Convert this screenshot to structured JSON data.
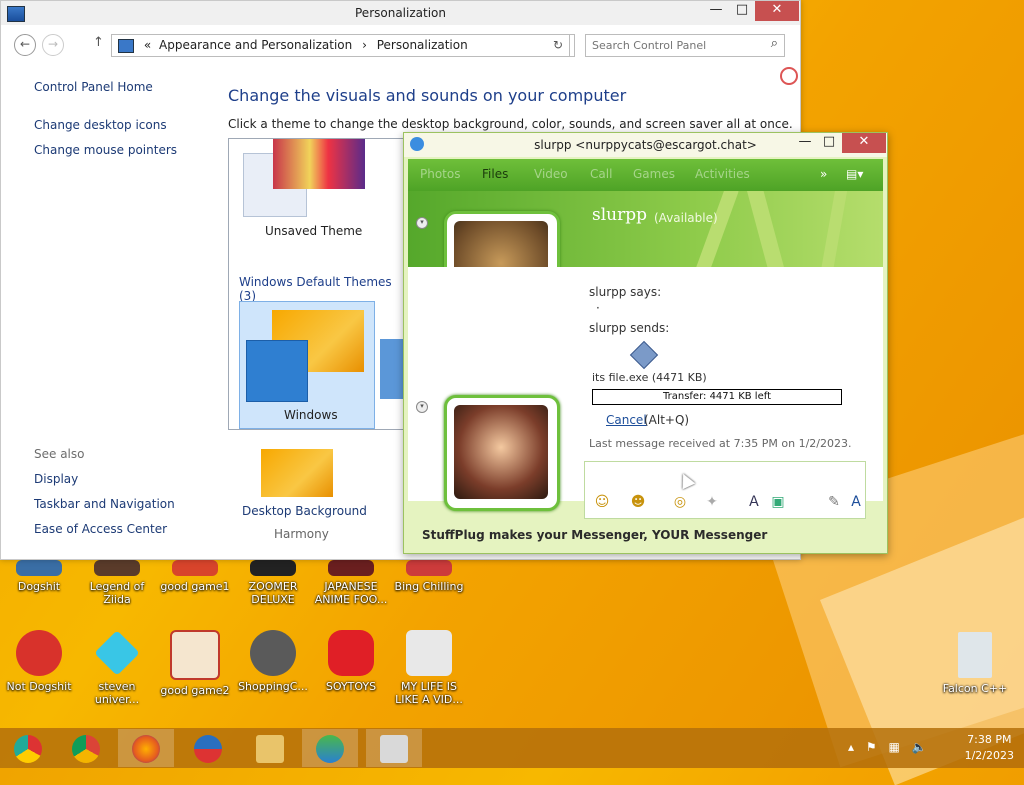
{
  "colors": {
    "accent": "#1e3f8a",
    "messenger_green": "#4ea326",
    "desktop": "#f0a400",
    "close": "#c75050"
  },
  "personalization": {
    "title": "Personalization",
    "address": {
      "prefix": "«",
      "crumbs": [
        "Appearance and Personalization",
        "Personalization"
      ],
      "separator": "›"
    },
    "search_placeholder": "Search Control Panel",
    "sidebar": [
      "Control Panel Home",
      "Change desktop icons",
      "Change mouse pointers"
    ],
    "see_also": {
      "header": "See also",
      "items": [
        "Display",
        "Taskbar and Navigation",
        "Ease of Access Center"
      ]
    },
    "heading": "Change the visuals and sounds on your computer",
    "subtitle": "Click a theme to change the desktop background, color, sounds, and screen saver all at once.",
    "unsaved_theme": "Unsaved Theme",
    "group_title": "Windows Default Themes (3)",
    "windows_theme": "Windows",
    "desktop_background": {
      "label": "Desktop Background",
      "value": "Harmony"
    }
  },
  "messenger": {
    "title": "slurpp <nurppycats@escargot.chat>",
    "tabs": [
      "Photos",
      "Files",
      "Video",
      "Call",
      "Games",
      "Activities"
    ],
    "active_tab": "Files",
    "contact_name": "slurpp",
    "contact_status": "(Available)",
    "says_label": "slurpp says:",
    "says_text": "·",
    "sends_label": "slurpp sends:",
    "file_name": "its file.exe (4471 KB)",
    "transfer_text": "Transfer: 4471 KB left",
    "cancel_label": "Cancel",
    "cancel_hotkey": "(Alt+Q)",
    "last_message": "Last message received at 7:35 PM on 1/2/2023.",
    "footer": "StuffPlug makes your Messenger, YOUR Messenger"
  },
  "desktop_icons_row1": [
    "Dogshit",
    "Legend of Ziida",
    "good game1",
    "ZOOMER DELUXE",
    "JAPANESE ANIME FOO...",
    "Bing Chilling"
  ],
  "desktop_icons_row2": [
    "Not Dogshit",
    "steven univer...",
    "good game2",
    "ShoppingC...",
    "SOYTOYS",
    "MY LIFE IS LIKE A VID..."
  ],
  "recycle_bin": "Falcon C++",
  "taskbar": {
    "pinned": [
      "Chrome-like browser",
      "Google Chrome",
      "Firefox",
      "Obama",
      "File Explorer",
      "Control Panel",
      "Windows Live Messenger"
    ],
    "time": "7:38 PM",
    "date": "1/2/2023"
  }
}
